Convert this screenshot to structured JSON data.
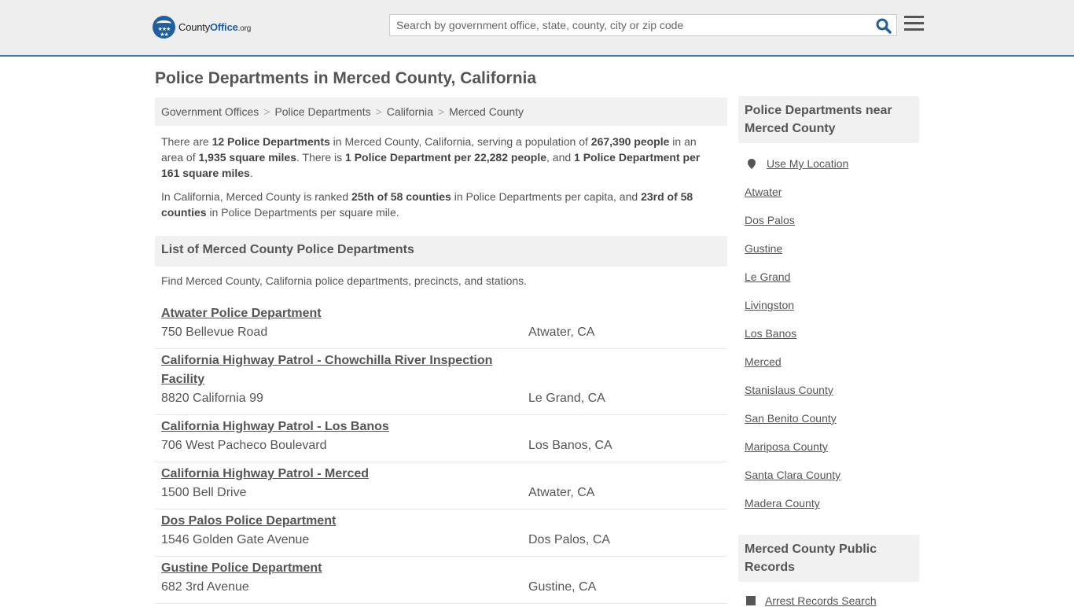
{
  "header": {
    "logo": {
      "prefix": "County",
      "brand": "Office",
      "suffix": ".org"
    },
    "search_placeholder": "Search by government office, state, county, city or zip code",
    "search_value": ""
  },
  "page_title": "Police Departments in Merced County, California",
  "breadcrumb": [
    "Government Offices",
    "Police Departments",
    "California",
    "Merced County"
  ],
  "intro": {
    "p1": [
      {
        "t": "There are ",
        "b": false
      },
      {
        "t": "12 Police Departments",
        "b": true
      },
      {
        "t": " in Merced County, California, serving a population of ",
        "b": false
      },
      {
        "t": "267,390 people",
        "b": true
      },
      {
        "t": " in an area of ",
        "b": false
      },
      {
        "t": "1,935 square miles",
        "b": true
      },
      {
        "t": ". There is ",
        "b": false
      },
      {
        "t": "1 Police Department per 22,282 people",
        "b": true
      },
      {
        "t": ", and ",
        "b": false
      },
      {
        "t": "1 Police Department per 161 square miles",
        "b": true
      },
      {
        "t": ".",
        "b": false
      }
    ],
    "p2": [
      {
        "t": "In California, Merced County is ranked ",
        "b": false
      },
      {
        "t": "25th of 58 counties",
        "b": true
      },
      {
        "t": " in Police Departments per capita, and ",
        "b": false
      },
      {
        "t": "23rd of 58 counties",
        "b": true
      },
      {
        "t": " in Police Departments per square mile.",
        "b": false
      }
    ]
  },
  "list": {
    "heading": "List of Merced County Police Departments",
    "description": "Find Merced County, California police departments, precincts, and stations.",
    "departments": [
      {
        "name": "Atwater Police Department",
        "address": "750 Bellevue Road",
        "city": "Atwater, CA"
      },
      {
        "name": "California Highway Patrol - Chowchilla River Inspection Facility",
        "address": "8820 California 99",
        "city": "Le Grand, CA"
      },
      {
        "name": "California Highway Patrol - Los Banos",
        "address": "706 West Pacheco Boulevard",
        "city": "Los Banos, CA"
      },
      {
        "name": "California Highway Patrol - Merced",
        "address": "1500 Bell Drive",
        "city": "Atwater, CA"
      },
      {
        "name": "Dos Palos Police Department",
        "address": "1546 Golden Gate Avenue",
        "city": "Dos Palos, CA"
      },
      {
        "name": "Gustine Police Department",
        "address": "682 3rd Avenue",
        "city": "Gustine, CA"
      }
    ]
  },
  "sidebar": {
    "nearby_heading": "Police Departments near Merced County",
    "use_location": "Use My Location",
    "nearby_links": [
      "Atwater",
      "Dos Palos",
      "Gustine",
      "Le Grand",
      "Livingston",
      "Los Banos",
      "Merced",
      "Stanislaus County",
      "San Benito County",
      "Mariposa County",
      "Santa Clara County",
      "Madera County"
    ],
    "records_heading": "Merced County Public Records",
    "records_links": [
      "Arrest Records Search"
    ]
  }
}
